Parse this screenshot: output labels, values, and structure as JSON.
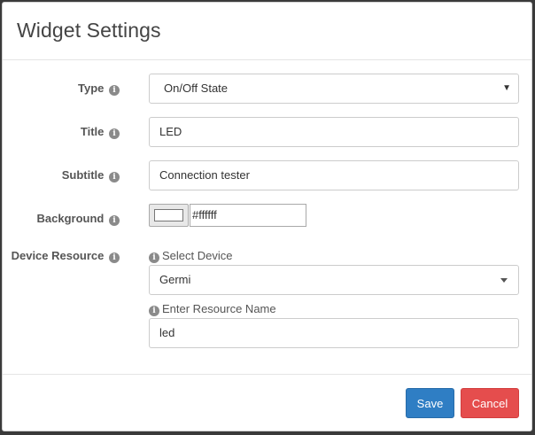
{
  "modal": {
    "title": "Widget Settings"
  },
  "fields": {
    "type": {
      "label": "Type",
      "value": "On/Off State"
    },
    "title": {
      "label": "Title",
      "value": "LED"
    },
    "subtitle": {
      "label": "Subtitle",
      "value": "Connection tester"
    },
    "background": {
      "label": "Background",
      "value": "#ffffff",
      "swatch_color": "#ffffff"
    },
    "device_resource": {
      "label": "Device Resource",
      "select_device_label": "Select Device",
      "device_value": "Germi",
      "resource_name_label": "Enter Resource Name",
      "resource_name_value": "led"
    }
  },
  "footer": {
    "save_label": "Save",
    "cancel_label": "Cancel"
  },
  "colors": {
    "primary": "#2f7ec4",
    "danger": "#e54d4d"
  },
  "icons": {
    "info": "info-circle-icon",
    "select_caret": "caret-down-icon"
  }
}
